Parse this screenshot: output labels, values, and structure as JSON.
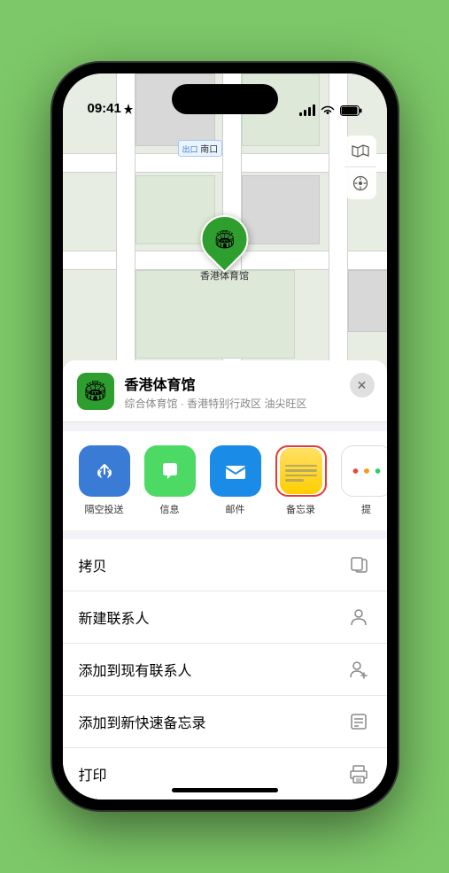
{
  "status_bar": {
    "time": "09:41",
    "location_arrow": "▶"
  },
  "map": {
    "label_text": "南口",
    "label_prefix": "出口"
  },
  "map_controls": {
    "map_icon": "🗺",
    "location_icon": "⊹"
  },
  "location_pin": {
    "emoji": "🏟",
    "label": "香港体育馆"
  },
  "place_card": {
    "name": "香港体育馆",
    "subtitle": "综合体育馆 · 香港特别行政区 油尖旺区",
    "close_label": "✕"
  },
  "share_items": [
    {
      "id": "airdrop",
      "bg": "#3a7bd5",
      "emoji": "📡",
      "label": "隔空投送"
    },
    {
      "id": "messages",
      "bg": "#4CD964",
      "emoji": "💬",
      "label": "信息"
    },
    {
      "id": "mail",
      "bg": "#1A8CE8",
      "emoji": "✉️",
      "label": "邮件"
    },
    {
      "id": "notes",
      "bg": "notes",
      "emoji": "notes",
      "label": "备忘录"
    },
    {
      "id": "more",
      "bg": "more",
      "emoji": "more",
      "label": "提"
    }
  ],
  "actions": [
    {
      "id": "copy",
      "label": "拷贝",
      "icon": "copy"
    },
    {
      "id": "new-contact",
      "label": "新建联系人",
      "icon": "person"
    },
    {
      "id": "add-contact",
      "label": "添加到现有联系人",
      "icon": "person-add"
    },
    {
      "id": "quick-note",
      "label": "添加到新快速备忘录",
      "icon": "quick-note"
    },
    {
      "id": "print",
      "label": "打印",
      "icon": "print"
    }
  ]
}
